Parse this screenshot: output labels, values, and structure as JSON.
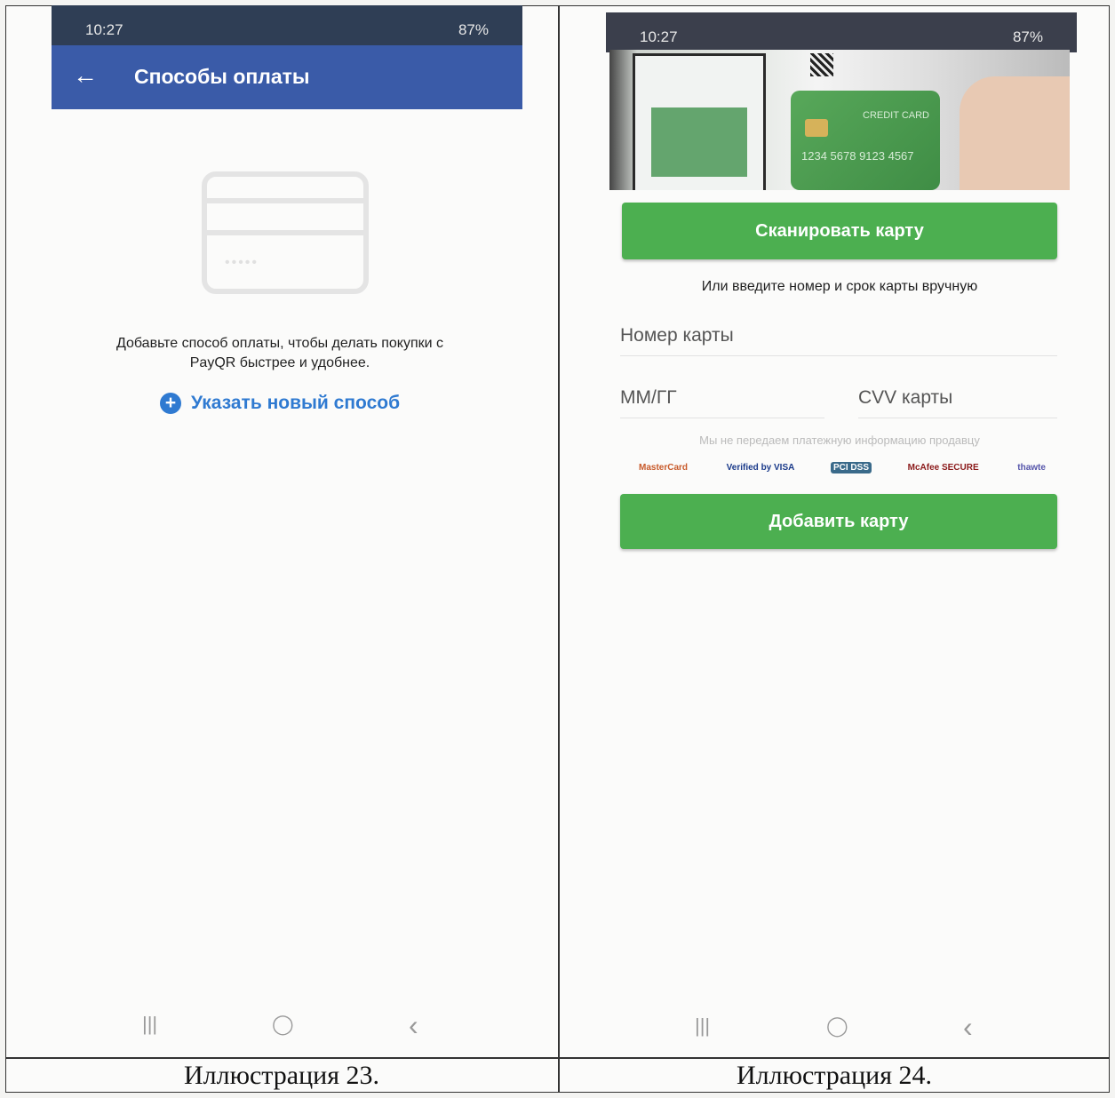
{
  "left": {
    "status": {
      "time": "10:27",
      "battery": "87%"
    },
    "title": "Способы оплаты",
    "card_digits": "•••••",
    "hint": "Добавьте способ оплаты, чтобы делать покупки с PayQR быстрее и удобнее.",
    "add_new": "Указать новый способ",
    "nav": {
      "recent": "|||",
      "home": "◯",
      "back": "‹"
    },
    "caption": "Иллюстрация 23."
  },
  "right": {
    "status": {
      "time": "10:27",
      "battery": "87%"
    },
    "camera": {
      "card_label": "CREDIT CARD",
      "card_number": "1234 5678 9123 4567"
    },
    "scan_button": "Сканировать карту",
    "manual_hint": "Или введите номер и срок карты вручную",
    "card_number_placeholder": "Номер карты",
    "expiry_placeholder": "ММ/ГГ",
    "cvv_placeholder": "CVV карты",
    "security_note": "Мы не передаем платежную информацию продавцу",
    "logos": [
      "MasterCard",
      "Verified by VISA",
      "PCI DSS",
      "McAfee SECURE",
      "thawte"
    ],
    "add_button": "Добавить карту",
    "nav": {
      "recent": "|||",
      "home": "◯",
      "back": "‹"
    },
    "caption": "Иллюстрация 24."
  },
  "colors": {
    "appbar": "#3a5ba8",
    "link": "#2f7ad1",
    "green": "#4caf50"
  }
}
